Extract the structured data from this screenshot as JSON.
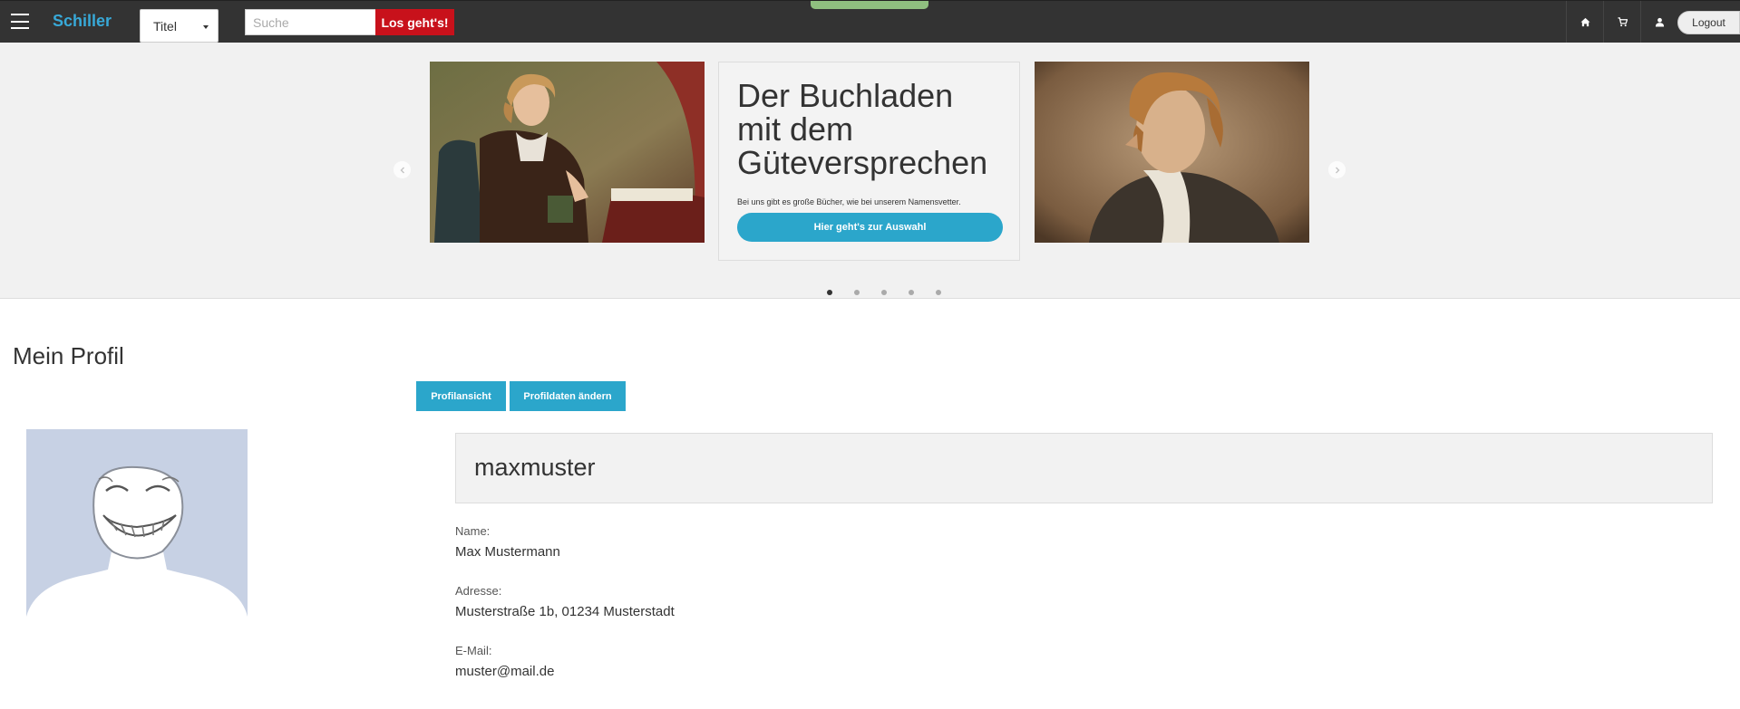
{
  "header": {
    "brand": "Schiller",
    "search_type": "Titel",
    "search_placeholder": "Suche",
    "search_button": "Los geht's!",
    "icons": [
      "home-icon",
      "cart-icon",
      "user-icon"
    ],
    "logout": "Logout"
  },
  "carousel": {
    "headline": "Der Buchladen mit dem Güteversprechen",
    "subtext": "Bei uns gibt es große Bücher, wie bei unserem Namensvetter.",
    "cta": "Hier geht's zur Auswahl",
    "slide_count": 5,
    "active_slide": 1
  },
  "profile": {
    "title": "Mein Profil",
    "tabs": [
      {
        "label": "Profilansicht"
      },
      {
        "label": "Profildaten ändern"
      }
    ],
    "username": "maxmuster",
    "fields": [
      {
        "label": "Name:",
        "value": "Max Mustermann"
      },
      {
        "label": "Adresse:",
        "value": "Musterstraße 1b, 01234 Musterstadt"
      },
      {
        "label": "E-Mail:",
        "value": "muster@mail.de"
      }
    ]
  },
  "colors": {
    "topbar": "#333333",
    "brand": "#38a9d8",
    "search_button": "#c8111b",
    "primary_button": "#2ba6cb",
    "avatar_bg": "#c7d1e4"
  }
}
